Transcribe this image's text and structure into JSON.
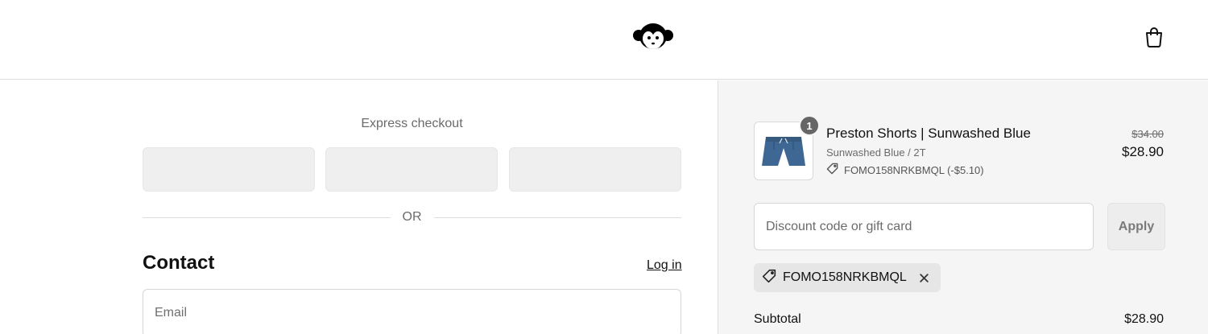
{
  "header": {
    "logo_icon": "monkey-logo-icon",
    "cart_icon": "shopping-bag-icon"
  },
  "checkout": {
    "express_title": "Express checkout",
    "express_buttons": [
      "",
      "",
      ""
    ],
    "or_text": "OR",
    "contact_title": "Contact",
    "login_label": "Log in",
    "email_placeholder": "Email"
  },
  "summary": {
    "product": {
      "quantity": "1",
      "name": "Preston Shorts | Sunwashed Blue",
      "variant": "Sunwashed Blue / 2T",
      "discount_line": "FOMO158NRKBMQL (-$5.10)",
      "original_price": "$34.00",
      "price": "$28.90"
    },
    "discount_placeholder": "Discount code or gift card",
    "apply_label": "Apply",
    "applied_code": "FOMO158NRKBMQL",
    "subtotal_label": "Subtotal",
    "subtotal_value": "$28.90"
  },
  "colors": {
    "summary_bg": "#f5f5f5",
    "chip_bg": "#e6e6e6",
    "badge_bg": "#666666"
  }
}
